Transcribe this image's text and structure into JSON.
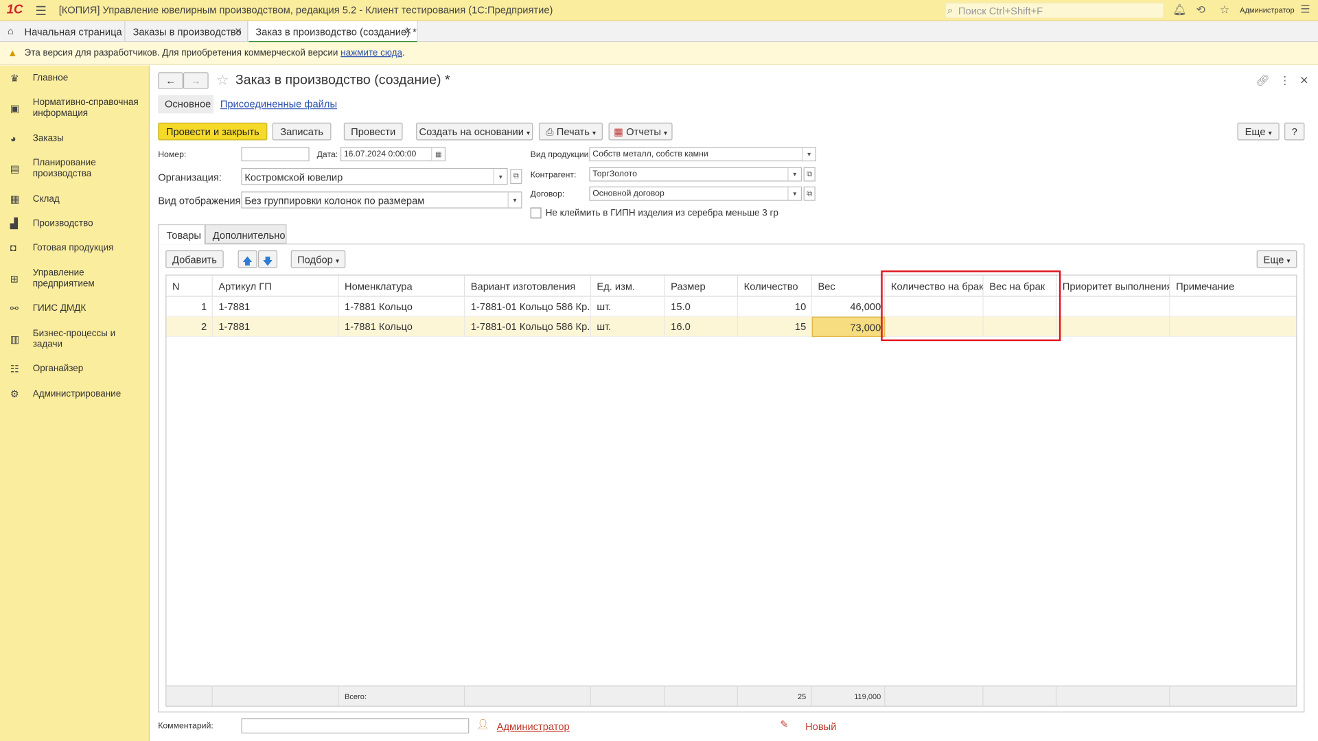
{
  "app": {
    "logo": "1С",
    "title": "[КОПИЯ] Управление ювелирным производством, редакция 5.2  - Клиент тестирования (1С:Предприятие)",
    "search_placeholder": "Поиск Ctrl+Shift+F",
    "user": "Администратор"
  },
  "window_tabs": [
    {
      "label": "Начальная страница"
    },
    {
      "label": "Заказы в производство"
    },
    {
      "label": "Заказ в производство (создание) *"
    }
  ],
  "notice": {
    "text": "Эта версия для разработчиков. Для приобретения коммерческой версии ",
    "link": "нажмите сюда",
    "tail": "."
  },
  "sidebar": {
    "items": [
      {
        "label": "Главное",
        "icon": "crown-icon"
      },
      {
        "label": "Нормативно-справочная информация",
        "icon": "book-icon"
      },
      {
        "label": "Заказы",
        "icon": "pie-icon"
      },
      {
        "label": "Планирование производства",
        "icon": "clipboard-icon"
      },
      {
        "label": "Склад",
        "icon": "grid-icon"
      },
      {
        "label": "Производство",
        "icon": "factory-icon"
      },
      {
        "label": "Готовая продукция",
        "icon": "bag-icon"
      },
      {
        "label": "Управление предприятием",
        "icon": "org-icon"
      },
      {
        "label": "ГИИС ДМДК",
        "icon": "link-icon"
      },
      {
        "label": "Бизнес-процессы и задачи",
        "icon": "tasks-icon"
      },
      {
        "label": "Органайзер",
        "icon": "organizer-icon"
      },
      {
        "label": "Администрирование",
        "icon": "gear-icon"
      }
    ]
  },
  "form": {
    "title": "Заказ в производство (создание) *",
    "subtabs": {
      "main": "Основное",
      "files": "Присоединенные файлы"
    },
    "toolbar": {
      "post_close": "Провести и закрыть",
      "save": "Записать",
      "post": "Провести",
      "create_based": "Создать на основании",
      "print": "Печать",
      "reports": "Отчеты",
      "more": "Еще",
      "help": "?"
    },
    "fields": {
      "number_label": "Номер:",
      "number_value": "",
      "date_label": "Дата:",
      "date_value": "16.07.2024  0:00:00",
      "org_label": "Организация:",
      "org_value": "Костромской ювелир",
      "display_label": "Вид отображения:",
      "display_value": "Без группировки колонок по размерам",
      "product_type_label": "Вид продукции:",
      "product_type_value": "Собств металл, собств камни",
      "counterparty_label": "Контрагент:",
      "counterparty_value": "ТоргЗолото",
      "contract_label": "Договор:",
      "contract_value": "Основной договор",
      "checkbox_label": "Не клеймить в ГИПН изделия из серебра меньше 3 гр",
      "checkbox_checked": false
    },
    "tabs": {
      "goods": "Товары",
      "extra": "Дополнительно"
    },
    "table_toolbar": {
      "add": "Добавить",
      "pick": "Подбор",
      "more": "Еще"
    },
    "table": {
      "columns": [
        "N",
        "Артикул ГП",
        "Номенклатура",
        "Вариант изготовления",
        "Ед. изм.",
        "Размер",
        "Количество",
        "Вес",
        "Количество на брак",
        "Вес на брак",
        "Приоритет выполнения",
        "Примечание"
      ],
      "rows": [
        {
          "n": "1",
          "article": "1-7881",
          "nomenclature": "1-7881 Кольцо",
          "variant": "1-7881-01 Кольцо 586 Кр...",
          "unit": "шт.",
          "size": "15.0",
          "qty": "10",
          "weight": "46,000",
          "defect_qty": "",
          "defect_weight": "",
          "priority": "",
          "note": ""
        },
        {
          "n": "2",
          "article": "1-7881",
          "nomenclature": "1-7881 Кольцо",
          "variant": "1-7881-01 Кольцо 586 Кр...",
          "unit": "шт.",
          "size": "16.0",
          "qty": "15",
          "weight": "73,000",
          "defect_qty": "",
          "defect_weight": "",
          "priority": "",
          "note": ""
        }
      ],
      "footer": {
        "label": "Всего:",
        "qty_total": "25",
        "weight_total": "119,000"
      }
    },
    "comment_label": "Комментарий:",
    "comment_value": "",
    "author": "Администратор",
    "status": "Новый"
  },
  "colors": {
    "accent_yellow": "#f6da29",
    "sidebar_bg": "#fbed9e",
    "highlight_frame": "#e0141e",
    "selected_row": "#fdf6d6"
  }
}
